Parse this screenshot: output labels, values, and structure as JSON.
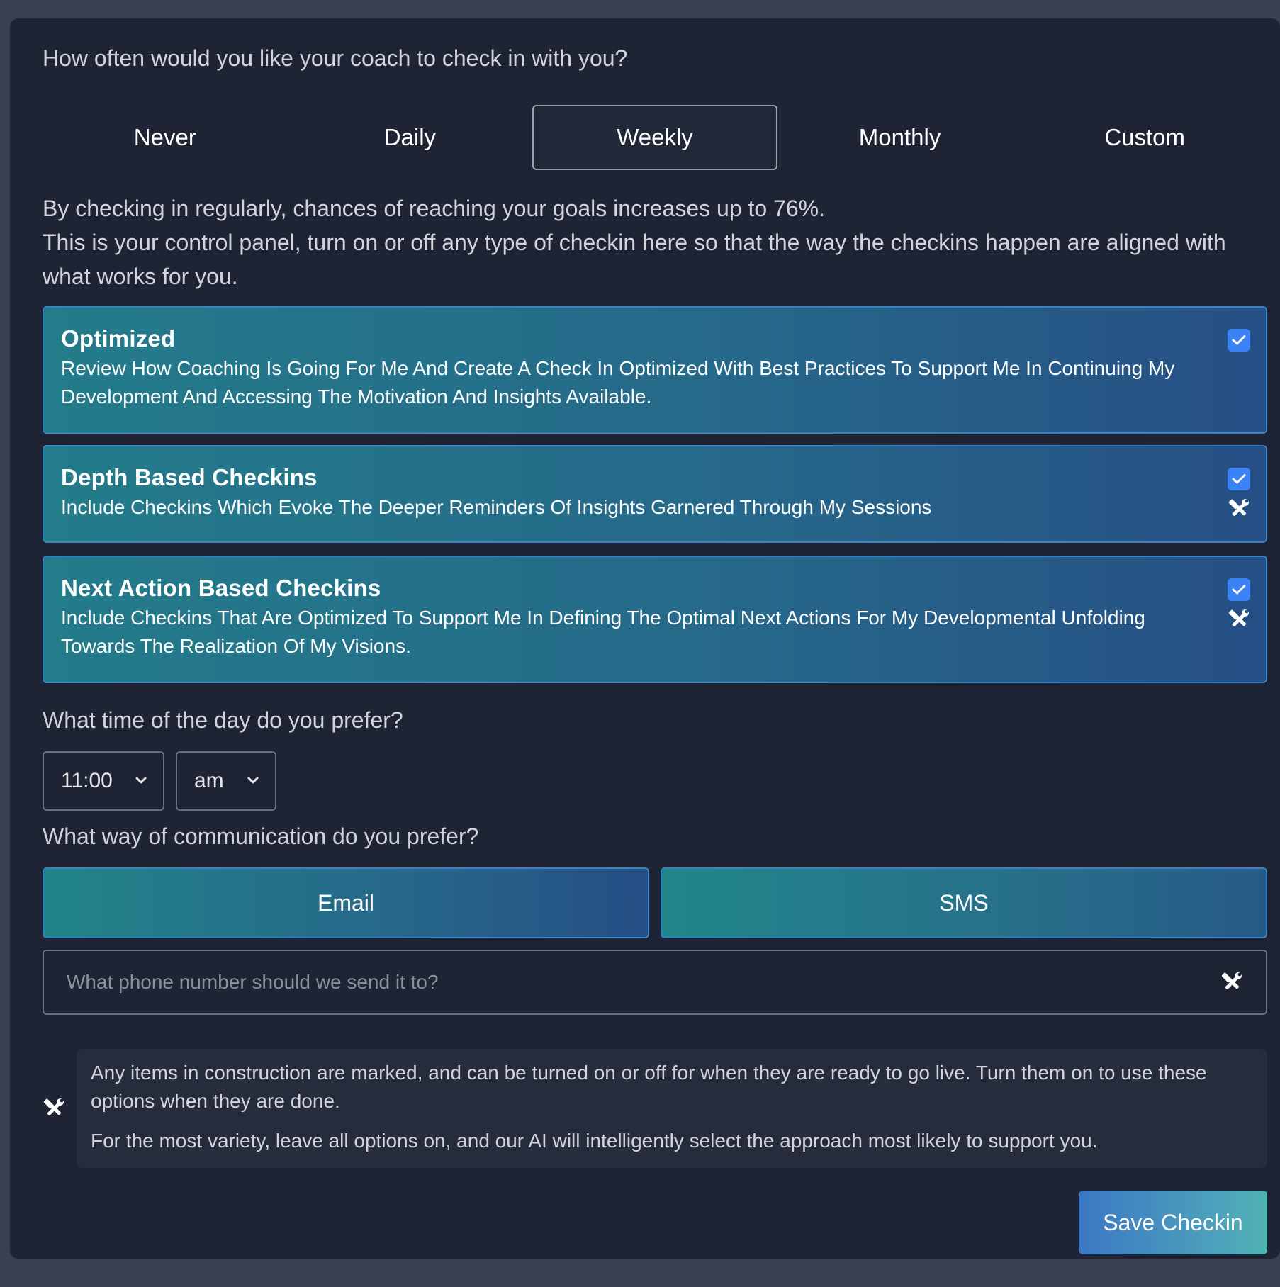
{
  "frequency": {
    "question": "How often would you like your coach to check in with you?",
    "options": [
      "Never",
      "Daily",
      "Weekly",
      "Monthly",
      "Custom"
    ],
    "selected": "Weekly"
  },
  "intro": {
    "line1": "By checking in regularly, chances of reaching your goals increases up to 76%.",
    "line2": "This is your control panel, turn on or off any type of checkin here so that the way the checkins happen are aligned with what works for you."
  },
  "checkin_types": [
    {
      "title": "Optimized",
      "description": "Review How Coaching Is Going For Me And Create A Check In Optimized With Best Practices To Support Me In Continuing My Development And Accessing The Motivation And Insights Available.",
      "checked": true,
      "in_construction": false
    },
    {
      "title": "Depth Based Checkins",
      "description": "Include Checkins Which Evoke The Deeper Reminders Of Insights Garnered Through My Sessions",
      "checked": true,
      "in_construction": true
    },
    {
      "title": "Next Action Based Checkins",
      "description": "Include Checkins That Are Optimized To Support Me In Defining The Optimal Next Actions For My Developmental Unfolding Towards The Realization Of My Visions.",
      "checked": true,
      "in_construction": true
    }
  ],
  "time": {
    "question": "What time of the day do you prefer?",
    "hour": "11:00",
    "period": "am"
  },
  "communication": {
    "question": "What way of communication do you prefer?",
    "email_label": "Email",
    "sms_label": "SMS",
    "phone_placeholder": "What phone number should we send it to?"
  },
  "note": {
    "line1": "Any items in construction are marked, and can be turned on or off for when they are ready to go live. Turn them on to use these options when they are done.",
    "line2": "For the most variety, leave all options on, and our AI will intelligently select the approach most likely to support you."
  },
  "save_label": "Save Checkin",
  "icons": {
    "checkbox": "check-icon",
    "construction": "hammer-wrench-icon",
    "dropdown": "chevron-down-icon"
  },
  "colors": {
    "background": "#1e2433",
    "checkbox": "#3b82f6",
    "card_gradient_start": "#237c8a",
    "card_gradient_end": "#264f85"
  }
}
